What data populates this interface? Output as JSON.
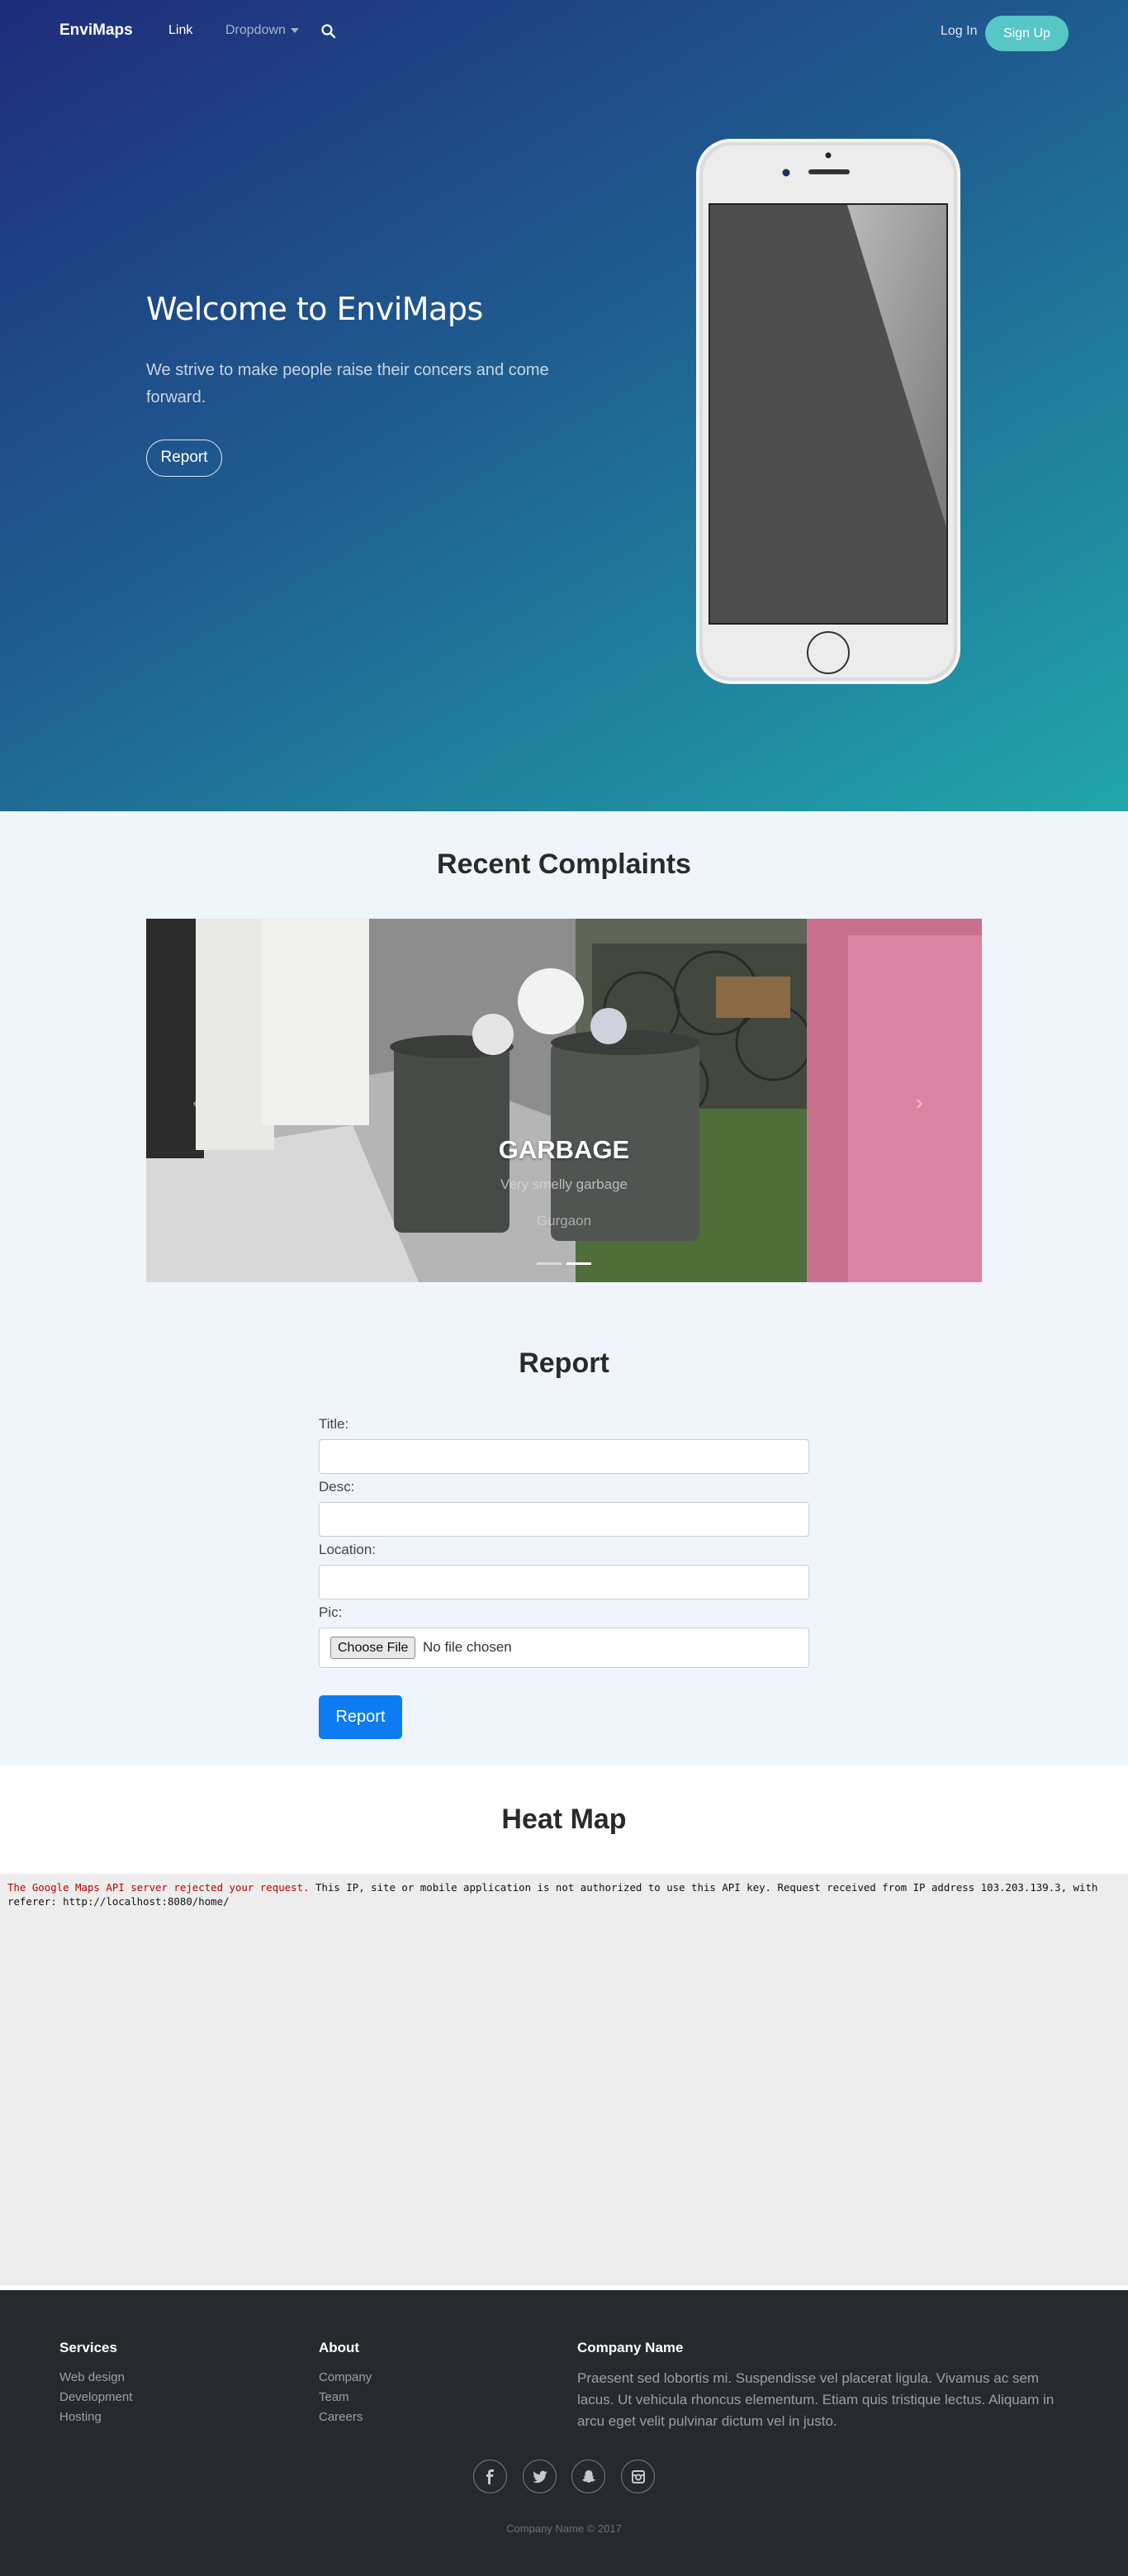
{
  "nav": {
    "brand": "EnviMaps",
    "link": "Link",
    "dropdown": "Dropdown",
    "login": "Log In",
    "signup": "Sign Up"
  },
  "hero": {
    "title": "Welcome to EnviMaps",
    "text": "We strive to make people raise their concers and come forward.",
    "button": "Report"
  },
  "complaints": {
    "title": "Recent Complaints",
    "slide": {
      "title": "GARBAGE",
      "desc": "Very smelly garbage",
      "location": "Gurgaon"
    },
    "prev": "‹",
    "next": "›"
  },
  "report": {
    "title": "Report",
    "title_label": "Title:",
    "desc_label": "Desc:",
    "location_label": "Location:",
    "pic_label": "Pic:",
    "file_button": "Choose File",
    "file_status": "No file chosen",
    "submit": "Report"
  },
  "heatmap": {
    "title": "Heat Map",
    "error_lead": "The Google Maps API server rejected your request.",
    "error_rest": " This IP, site or mobile application is not authorized to use this API key. Request received from IP address 103.203.139.3, with referer: http://localhost:8080/home/"
  },
  "footer": {
    "services": {
      "title": "Services",
      "items": [
        "Web design",
        "Development",
        "Hosting"
      ]
    },
    "about": {
      "title": "About",
      "items": [
        "Company",
        "Team",
        "Careers"
      ]
    },
    "company": {
      "title": "Company Name",
      "text": "Praesent sed lobortis mi. Suspendisse vel placerat ligula. Vivamus ac sem lacus. Ut vehicula rhoncus elementum. Etiam quis tristique lectus. Aliquam in arcu eget velit pulvinar dictum vel in justo."
    },
    "socials": [
      "facebook-icon",
      "twitter-icon",
      "snapchat-icon",
      "instagram-icon"
    ],
    "copyright": "Company Name © 2017"
  },
  "colors": {
    "hero_start": "#1f2c7a",
    "hero_end": "#21a6ab",
    "signup": "#56c6c6",
    "primary": "#0d7cf2",
    "section_bg": "#f0f5fb",
    "footer_bg": "#262a2f"
  }
}
